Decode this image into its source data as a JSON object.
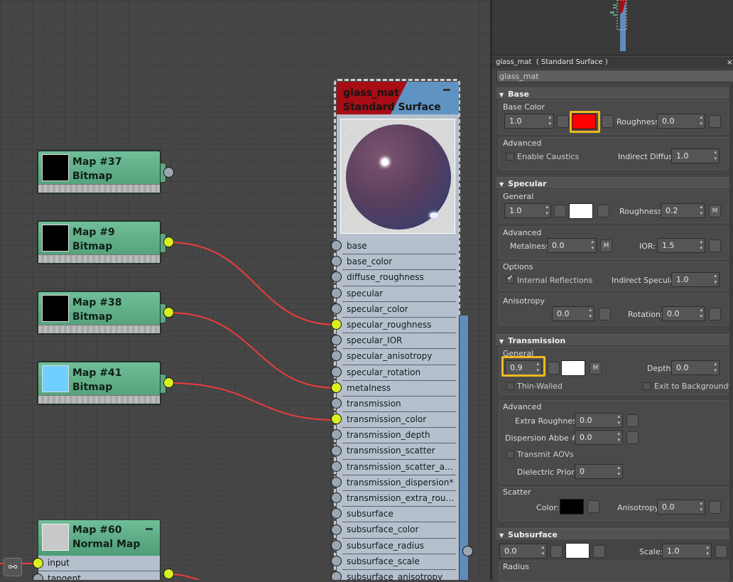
{
  "canvas": {
    "map_nodes": [
      {
        "title": "Map #37",
        "subtitle": "Bitmap",
        "thumb_color": "#000000"
      },
      {
        "title": "Map #9",
        "subtitle": "Bitmap",
        "thumb_color": "#000000"
      },
      {
        "title": "Map #38",
        "subtitle": "Bitmap",
        "thumb_color": "#000000"
      },
      {
        "title": "Map #41",
        "subtitle": "Bitmap",
        "thumb_color": "#6fd0ff"
      }
    ],
    "material_node": {
      "name": "glass_mat",
      "type": "Standard Surface",
      "ports": [
        "base",
        "base_color",
        "diffuse_roughness",
        "specular",
        "specular_color",
        "specular_roughness",
        "specular_IOR",
        "specular_anisotropy",
        "specular_rotation",
        "metalness",
        "transmission",
        "transmission_color",
        "transmission_depth",
        "transmission_scatter",
        "transmission_scatter_ani...",
        "transmission_dispersion*",
        "transmission_extra_roug...",
        "subsurface",
        "subsurface_color",
        "subsurface_radius",
        "subsurface_scale",
        "subsurface_anisotropy"
      ],
      "connected_ports": [
        "specular_roughness",
        "metalness",
        "transmission_color"
      ]
    },
    "normal_map_node": {
      "title": "Map #60",
      "subtitle": "Normal Map",
      "ports": [
        "input",
        "tangent"
      ]
    },
    "nav_icon": "binoculars-icon"
  },
  "panel": {
    "title": "glass_mat  ( Standard Surface )",
    "name_value": "glass_mat",
    "base": {
      "label": "Base",
      "base_color_label": "Base Color",
      "weight": "1.0",
      "color": "#ff0000",
      "roughness_label": "Roughness:",
      "roughness": "0.0",
      "advanced_label": "Advanced",
      "enable_caustics": "Enable Caustics",
      "indirect_diffuse_label": "Indirect Diffuse:",
      "indirect_diffuse": "1.0"
    },
    "specular": {
      "label": "Specular",
      "general_label": "General",
      "weight": "1.0",
      "color": "#ffffff",
      "roughness_label": "Roughness:",
      "roughness": "0.2",
      "map_btn": "M",
      "advanced_label": "Advanced",
      "metalness_label": "Metalness:",
      "metalness": "0.0",
      "metalness_map_btn": "M",
      "ior_label": "IOR:",
      "ior": "1.5",
      "options_label": "Options",
      "internal_reflections": "Internal Reflections",
      "indirect_specular_label": "Indirect Specular:",
      "indirect_specular": "1.0",
      "anisotropy_label": "Anisotropy",
      "anisotropy": "0.0",
      "rotation_label": "Rotation:",
      "rotation": "0.0"
    },
    "transmission": {
      "label": "Transmission",
      "general_label": "General",
      "weight": "0.9",
      "color": "#ffffff",
      "map_btn": "M",
      "depth_label": "Depth:",
      "depth": "0.0",
      "thin_walled": "Thin-Walled",
      "exit_to_background": "Exit to Background*",
      "advanced_label": "Advanced",
      "extra_roughness_label": "Extra Roughness:",
      "extra_roughness": "0.0",
      "dispersion_label": "Dispersion Abbe #*:",
      "dispersion": "0.0",
      "transmit_aovs": "Transmit AOVs",
      "dielectric_priority_label": "Dielectric Priority",
      "dielectric_priority": "0",
      "scatter_label": "Scatter",
      "scatter_color_label": "Color:",
      "scatter_color": "#000000",
      "scatter_anisotropy_label": "Anisotropy:",
      "scatter_anisotropy": "0.0"
    },
    "subsurface": {
      "label": "Subsurface",
      "weight": "0.0",
      "color": "#ffffff",
      "scale_label": "Scale:",
      "scale": "1.0",
      "radius_label": "Radius"
    }
  }
}
